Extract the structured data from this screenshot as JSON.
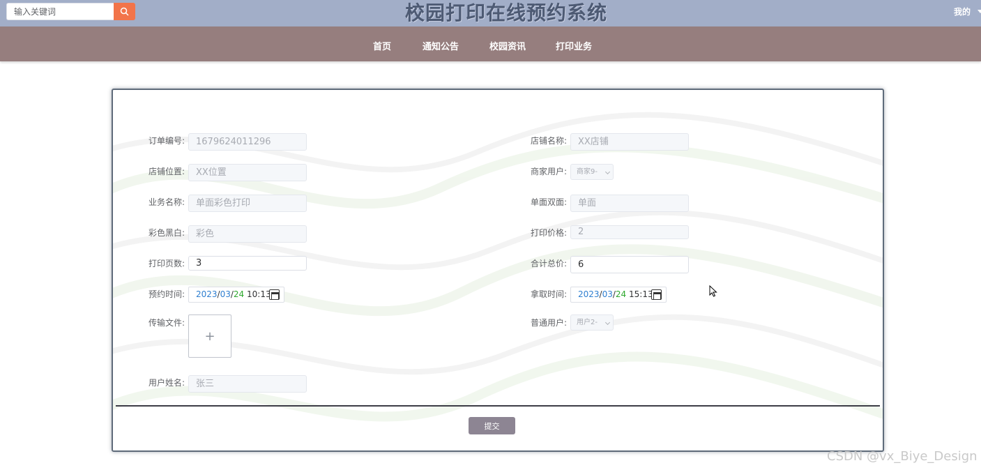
{
  "header": {
    "title": "校园打印在线预约系统",
    "search_placeholder": "输入关键词",
    "user_menu": "我的"
  },
  "nav": {
    "items": [
      "首页",
      "通知公告",
      "校园资讯",
      "打印业务"
    ]
  },
  "form": {
    "order_no": {
      "label": "订单编号:",
      "value": "1679624011296"
    },
    "shop_name": {
      "label": "店铺名称:",
      "value": "XX店铺"
    },
    "shop_location": {
      "label": "店铺位置:",
      "value": "XX位置"
    },
    "merchant_user": {
      "label": "商家用户:",
      "value": "商家9-"
    },
    "business_name": {
      "label": "业务名称:",
      "value": "单面彩色打印"
    },
    "single_double": {
      "label": "单面双面:",
      "value": "单面"
    },
    "color_bw": {
      "label": "彩色黑白:",
      "value": "彩色"
    },
    "print_price": {
      "label": "打印价格:",
      "value": "2"
    },
    "print_pages": {
      "label": "打印页数:",
      "value": "3"
    },
    "total_price": {
      "label": "合计总价:",
      "value": "6"
    },
    "appointment_time": {
      "label": "预约时间:",
      "year": "2023",
      "month": "03",
      "day": "24",
      "time": "10:13"
    },
    "pickup_time": {
      "label": "拿取时间:",
      "year": "2023",
      "month": "03",
      "day": "24",
      "time": "15:13"
    },
    "upload_file": {
      "label": "传输文件:",
      "plus": "+"
    },
    "normal_user": {
      "label": "普通用户:",
      "value": "用户2-"
    },
    "user_name": {
      "label": "用户姓名:",
      "value": "张三"
    },
    "submit_label": "提交"
  },
  "watermark": "CSDN @vx_Biye_Design",
  "colors": {
    "topbar": "#a2aec8",
    "navbar": "#967e7e",
    "search_button": "#f2744a",
    "submit_button": "#8d8593"
  },
  "icons": {
    "search": "search-icon",
    "calendar": "calendar-icon",
    "chevron": "chevron-down-icon"
  }
}
